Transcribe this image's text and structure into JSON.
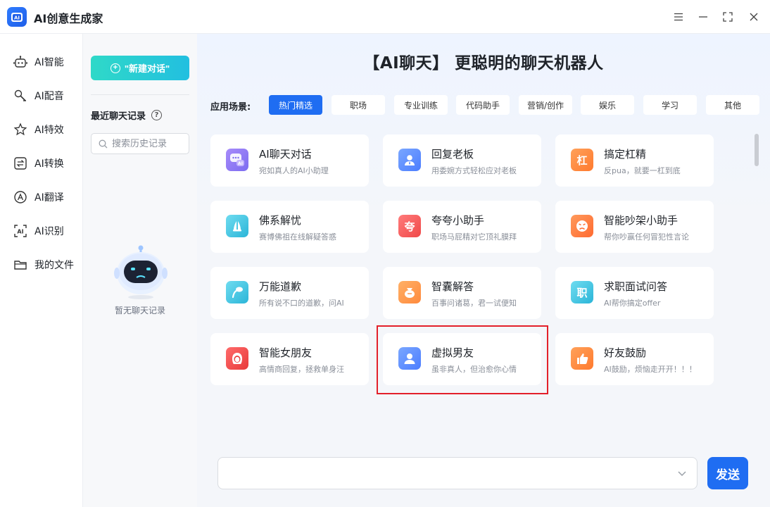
{
  "app": {
    "title": "AI创意生成家",
    "logo_text": "AI"
  },
  "nav": {
    "items": [
      {
        "label": "AI智能"
      },
      {
        "label": "AI配音"
      },
      {
        "label": "AI特效"
      },
      {
        "label": "AI转换"
      },
      {
        "label": "AI翻译"
      },
      {
        "label": "AI识别"
      },
      {
        "label": "我的文件"
      }
    ]
  },
  "history": {
    "new_chat_label": "\"新建对话\"",
    "title": "最近聊天记录",
    "search_placeholder": "搜索历史记录",
    "empty_text": "暂无聊天记录"
  },
  "main": {
    "title": "【AI聊天】 更聪明的聊天机器人",
    "scene_label": "应用场景:",
    "tabs": [
      {
        "label": "热门精选",
        "active": true
      },
      {
        "label": "职场"
      },
      {
        "label": "专业训练"
      },
      {
        "label": "代码助手"
      },
      {
        "label": "营销/创作"
      },
      {
        "label": "娱乐"
      },
      {
        "label": "学习"
      },
      {
        "label": "其他"
      }
    ],
    "cards": [
      {
        "title": "AI聊天对话",
        "desc": "宛如真人的AI小助理",
        "icon": "chat-bubble-icon",
        "color": "#8b7cf6",
        "glyph": "AI"
      },
      {
        "title": "回复老板",
        "desc": "用委婉方式轻松应对老板",
        "icon": "person-icon",
        "color": "#5b8dff",
        "glyph": ""
      },
      {
        "title": "搞定杠精",
        "desc": "反pua，就要一杠到底",
        "icon": "bar-icon",
        "color": "#ff8a3d",
        "glyph": "杠"
      },
      {
        "title": "佛系解忧",
        "desc": "赛博佛祖在线解疑答惑",
        "icon": "praying-hands-icon",
        "color": "#3ec7e0",
        "glyph": ""
      },
      {
        "title": "夸夸小助手",
        "desc": "职场马屁精对它顶礼膜拜",
        "icon": "praise-icon",
        "color": "#ff5a5a",
        "glyph": "夸"
      },
      {
        "title": "智能吵架小助手",
        "desc": "帮你吵赢任何冒犯性言论",
        "icon": "angry-face-icon",
        "color": "#ff7a45",
        "glyph": ""
      },
      {
        "title": "万能道歉",
        "desc": "所有说不口的道歉，问AI",
        "icon": "apology-icon",
        "color": "#3ec7e0",
        "glyph": ""
      },
      {
        "title": "智囊解答",
        "desc": "百事问诸葛，君一试便知",
        "icon": "wisdom-bag-icon",
        "color": "#ff9a45",
        "glyph": ""
      },
      {
        "title": "求职面试问答",
        "desc": "AI帮你搞定offer",
        "icon": "job-icon",
        "color": "#3ec7e0",
        "glyph": "职"
      },
      {
        "title": "智能女朋友",
        "desc": "高情商回复，拯救单身汪",
        "icon": "girlfriend-icon",
        "color": "#ff4d4f",
        "glyph": ""
      },
      {
        "title": "虚拟男友",
        "desc": "虽非真人，但治愈你心情",
        "icon": "boyfriend-icon",
        "color": "#5b8dff",
        "glyph": ""
      },
      {
        "title": "好友鼓励",
        "desc": "AI鼓励，烦恼走开开！！！",
        "icon": "thumbs-up-icon",
        "color": "#ff8a3d",
        "glyph": ""
      }
    ],
    "input_placeholder": "",
    "send_label": "发送"
  }
}
